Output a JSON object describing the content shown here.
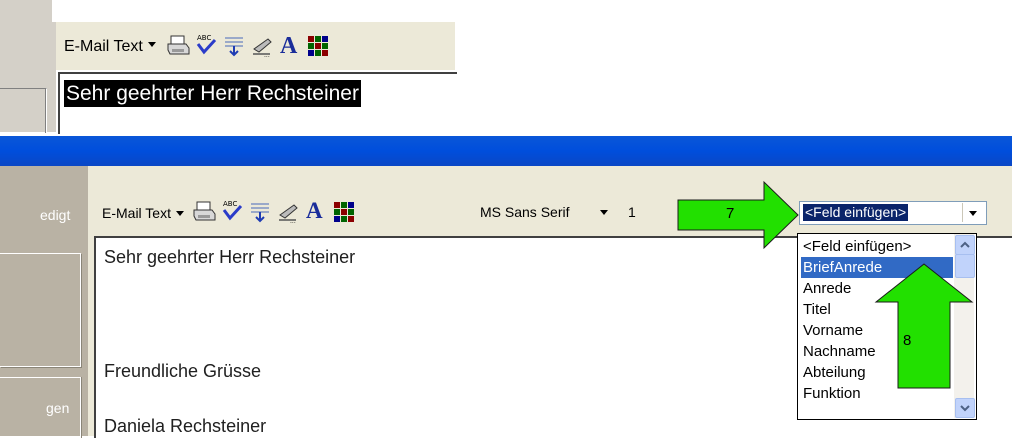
{
  "top_excerpt": {
    "toolbar": {
      "mail_format_label": "E-Mail Text"
    },
    "editor": {
      "selected_text": "Sehr geehrter Herr Rechsteiner"
    }
  },
  "bottom_window": {
    "sidebar": {
      "item_1": "edigt",
      "item_2": "gen"
    },
    "toolbar": {
      "mail_format_label": "E-Mail Text",
      "font_name": "MS Sans Serif",
      "font_size": "1",
      "field_insert_value": "<Feld einfügen>"
    },
    "editor": {
      "lines": [
        "Sehr geehrter Herr Rechsteiner",
        "Freundliche Grüsse",
        "Daniela Rechsteiner"
      ]
    },
    "field_dropdown": {
      "items": [
        "<Feld einfügen>",
        "BriefAnrede",
        "Anrede",
        "Titel",
        "Vorname",
        "Nachname",
        "Abteilung",
        "Funktion"
      ],
      "selected_index": 1
    }
  },
  "annotations": {
    "step_7": "7",
    "step_8": "8"
  },
  "colors": {
    "annotation_arrow": "#22e000",
    "title_band": "#0050d8",
    "selection": "#316ac5"
  }
}
